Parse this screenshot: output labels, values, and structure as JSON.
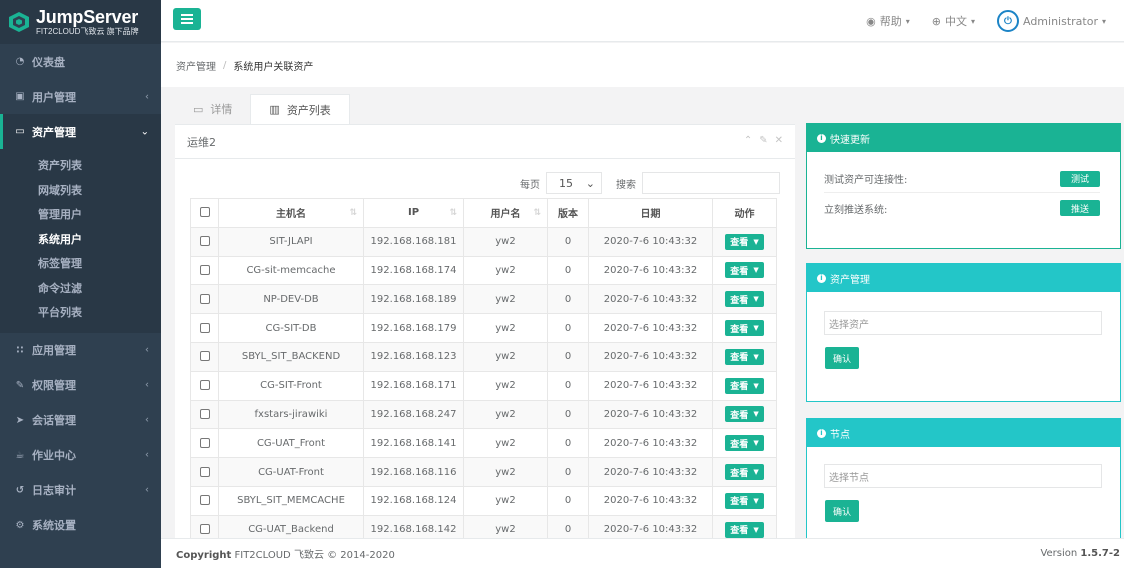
{
  "brand": {
    "title": "JumpServer",
    "subtitle": "FIT2CLOUD飞致云 旗下品牌"
  },
  "sidebar": {
    "items": [
      {
        "label": "仪表盘",
        "icon": "dashboard-icon",
        "glyph": "◔"
      },
      {
        "label": "用户管理",
        "icon": "users-icon",
        "glyph": "▣"
      },
      {
        "label": "资产管理",
        "icon": "inbox-icon",
        "glyph": "▭"
      },
      {
        "label": "应用管理",
        "icon": "grid-icon",
        "glyph": "∷"
      },
      {
        "label": "权限管理",
        "icon": "edit-icon",
        "glyph": "✎"
      },
      {
        "label": "会话管理",
        "icon": "rocket-icon",
        "glyph": "➤"
      },
      {
        "label": "作业中心",
        "icon": "coffee-icon",
        "glyph": "☕"
      },
      {
        "label": "日志审计",
        "icon": "history-icon",
        "glyph": "↺"
      },
      {
        "label": "系统设置",
        "icon": "gears-icon",
        "glyph": "⚙"
      }
    ],
    "asset_submenu": [
      "资产列表",
      "网域列表",
      "管理用户",
      "系统用户",
      "标签管理",
      "命令过滤",
      "平台列表"
    ]
  },
  "topbar": {
    "help": "帮助",
    "language": "中文",
    "user": "Administrator"
  },
  "breadcrumb": {
    "parent": "资产管理",
    "current": "系统用户关联资产"
  },
  "tabs": {
    "detail": "详情",
    "asset_list": "资产列表"
  },
  "panel": {
    "title": "运维2",
    "per_page_label": "每页",
    "per_page_value": "15",
    "search_label": "搜索"
  },
  "table": {
    "headers": [
      "主机名",
      "IP",
      "用户名",
      "版本",
      "日期",
      "动作"
    ],
    "action_label": "查看",
    "rows": [
      {
        "hostname": "SIT-JLAPI",
        "ip": "192.168.168.181",
        "username": "yw2",
        "version": "0",
        "date": "2020-7-6 10:43:32"
      },
      {
        "hostname": "CG-sit-memcache",
        "ip": "192.168.168.174",
        "username": "yw2",
        "version": "0",
        "date": "2020-7-6 10:43:32"
      },
      {
        "hostname": "NP-DEV-DB",
        "ip": "192.168.168.189",
        "username": "yw2",
        "version": "0",
        "date": "2020-7-6 10:43:32"
      },
      {
        "hostname": "CG-SIT-DB",
        "ip": "192.168.168.179",
        "username": "yw2",
        "version": "0",
        "date": "2020-7-6 10:43:32"
      },
      {
        "hostname": "SBYL_SIT_BACKEND",
        "ip": "192.168.168.123",
        "username": "yw2",
        "version": "0",
        "date": "2020-7-6 10:43:32"
      },
      {
        "hostname": "CG-SIT-Front",
        "ip": "192.168.168.171",
        "username": "yw2",
        "version": "0",
        "date": "2020-7-6 10:43:32"
      },
      {
        "hostname": "fxstars-jirawiki",
        "ip": "192.168.168.247",
        "username": "yw2",
        "version": "0",
        "date": "2020-7-6 10:43:32"
      },
      {
        "hostname": "CG-UAT_Front",
        "ip": "192.168.168.141",
        "username": "yw2",
        "version": "0",
        "date": "2020-7-6 10:43:32"
      },
      {
        "hostname": "CG-UAT-Front",
        "ip": "192.168.168.116",
        "username": "yw2",
        "version": "0",
        "date": "2020-7-6 10:43:32"
      },
      {
        "hostname": "SBYL_SIT_MEMCACHE",
        "ip": "192.168.168.124",
        "username": "yw2",
        "version": "0",
        "date": "2020-7-6 10:43:32"
      },
      {
        "hostname": "CG-UAT_Backend",
        "ip": "192.168.168.142",
        "username": "yw2",
        "version": "0",
        "date": "2020-7-6 10:43:32"
      }
    ]
  },
  "quick_update": {
    "title": "快速更新",
    "test_label": "测试资产可连接性:",
    "test_button": "测试",
    "push_label": "立刻推送系统:",
    "push_button": "推送"
  },
  "asset_mgmt": {
    "title": "资产管理",
    "placeholder": "选择资产",
    "confirm": "确认"
  },
  "node": {
    "title": "节点",
    "placeholder": "选择节点",
    "confirm": "确认"
  },
  "footer": {
    "copyright_bold": "Copyright",
    "copyright_rest": "FIT2CLOUD 飞致云 © 2014-2020",
    "version_label": "Version",
    "version_value": "1.5.7-2"
  },
  "colors": {
    "primary": "#1ab394",
    "info": "#23c6c8",
    "sidebar": "#2f4050"
  }
}
